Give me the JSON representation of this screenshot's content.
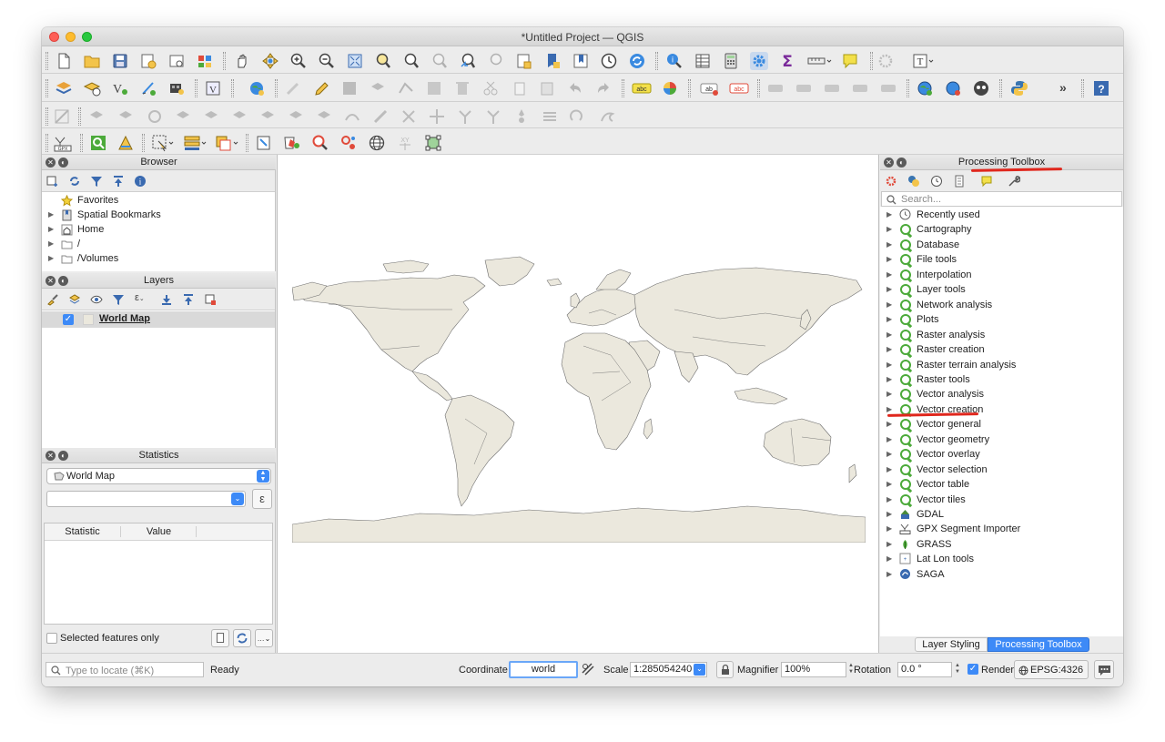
{
  "window": {
    "title": "*Untitled Project — QGIS"
  },
  "browser_panel": {
    "title": "Browser",
    "items": [
      {
        "label": "Favorites",
        "icon": "star-icon"
      },
      {
        "label": "Spatial Bookmarks",
        "icon": "bookmark-icon"
      },
      {
        "label": "Home",
        "icon": "home-icon"
      },
      {
        "label": "/",
        "icon": "folder-icon"
      },
      {
        "label": "/Volumes",
        "icon": "folder-icon"
      }
    ]
  },
  "layers_panel": {
    "title": "Layers",
    "layers": [
      {
        "label": "World Map",
        "checked": true
      }
    ]
  },
  "statistics_panel": {
    "title": "Statistics",
    "layer_select": "World Map",
    "expression_button": "ε",
    "columns": [
      "Statistic",
      "Value"
    ],
    "selected_only_label": "Selected features only"
  },
  "processing_toolbox": {
    "title": "Processing Toolbox",
    "search_placeholder": "Search...",
    "groups": [
      {
        "label": "Recently used",
        "icon": "clock-icon"
      },
      {
        "label": "Cartography",
        "icon": "qgis-icon"
      },
      {
        "label": "Database",
        "icon": "qgis-icon"
      },
      {
        "label": "File tools",
        "icon": "qgis-icon"
      },
      {
        "label": "Interpolation",
        "icon": "qgis-icon"
      },
      {
        "label": "Layer tools",
        "icon": "qgis-icon"
      },
      {
        "label": "Network analysis",
        "icon": "qgis-icon"
      },
      {
        "label": "Plots",
        "icon": "qgis-icon"
      },
      {
        "label": "Raster analysis",
        "icon": "qgis-icon"
      },
      {
        "label": "Raster creation",
        "icon": "qgis-icon"
      },
      {
        "label": "Raster terrain analysis",
        "icon": "qgis-icon"
      },
      {
        "label": "Raster tools",
        "icon": "qgis-icon"
      },
      {
        "label": "Vector analysis",
        "icon": "qgis-icon"
      },
      {
        "label": "Vector creation",
        "icon": "qgis-icon"
      },
      {
        "label": "Vector general",
        "icon": "qgis-icon"
      },
      {
        "label": "Vector geometry",
        "icon": "qgis-icon"
      },
      {
        "label": "Vector overlay",
        "icon": "qgis-icon"
      },
      {
        "label": "Vector selection",
        "icon": "qgis-icon"
      },
      {
        "label": "Vector table",
        "icon": "qgis-icon"
      },
      {
        "label": "Vector tiles",
        "icon": "qgis-icon"
      },
      {
        "label": "GDAL",
        "icon": "gdal-icon"
      },
      {
        "label": "GPX Segment Importer",
        "icon": "gpx-icon"
      },
      {
        "label": "GRASS",
        "icon": "grass-icon"
      },
      {
        "label": "Lat Lon tools",
        "icon": "latlon-icon"
      },
      {
        "label": "SAGA",
        "icon": "saga-icon"
      }
    ],
    "tabs": [
      {
        "label": "Layer Styling"
      },
      {
        "label": "Processing Toolbox",
        "active": true
      }
    ]
  },
  "statusbar": {
    "locate_placeholder": "Type to locate (⌘K)",
    "ready": "Ready",
    "coordinate_label": "Coordinate",
    "coordinate_value": "world",
    "scale_label": "Scale",
    "scale_value": "1:285054240",
    "magnifier_label": "Magnifier",
    "magnifier_value": "100%",
    "rotation_label": "Rotation",
    "rotation_value": "0.0 °",
    "render_label": "Render",
    "crs": "EPSG:4326"
  },
  "colors": {
    "accent": "#3d8af7",
    "annotation": "#e0271d",
    "land": "#ebe8dd",
    "qgis_green": "#4caa3a"
  }
}
